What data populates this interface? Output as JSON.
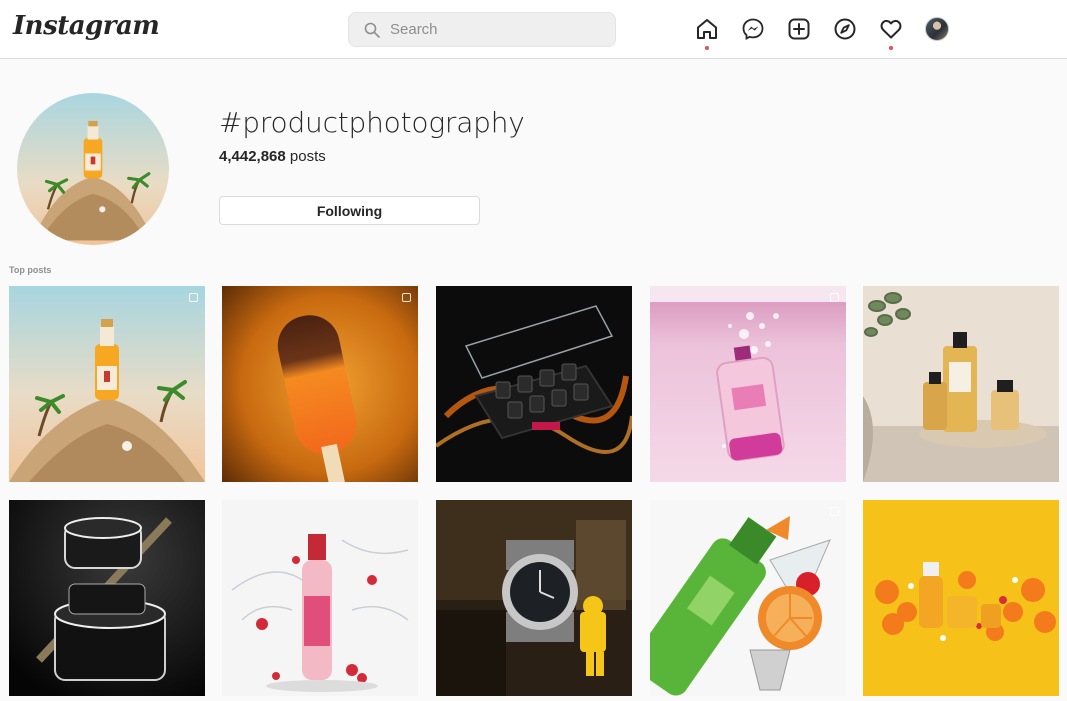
{
  "header": {
    "logo": "Instagram",
    "search": {
      "placeholder": "Search",
      "value": ""
    },
    "nav": [
      {
        "icon": "home-icon",
        "label": "Home",
        "notification": true
      },
      {
        "icon": "messenger-icon",
        "label": "Direct"
      },
      {
        "icon": "new-post-icon",
        "label": "New post"
      },
      {
        "icon": "explore-icon",
        "label": "Explore"
      },
      {
        "icon": "activity-heart-icon",
        "label": "Activity",
        "notification": true
      },
      {
        "icon": "profile-avatar",
        "label": "Profile"
      }
    ],
    "accent": "#ed4956"
  },
  "hashtag": {
    "name": "#productphotography",
    "post_count": "4,442,868",
    "post_suffix": " posts",
    "follow_button": "Following"
  },
  "section": {
    "label": "Top posts"
  },
  "posts": [
    {
      "subject": "orange juice bottle on sand island with palm trees",
      "multi": true
    },
    {
      "subject": "chocolate and orange popsicle on orange background",
      "multi": true
    },
    {
      "subject": "nail polish bottles in black box with acrylic lid and orange light trails"
    },
    {
      "subject": "perfume bottle splashing in pink water",
      "multi": true
    },
    {
      "subject": "skincare dropper bottles on tray with eucalyptus"
    },
    {
      "subject": "black cosmetic cream jars on dark background"
    },
    {
      "subject": "pink drink bottle with water splash and raspberries"
    },
    {
      "subject": "wristwatch with lego figure on vintage desk"
    },
    {
      "subject": "green gin bottle with orange slices and cocktail glass",
      "multi": true
    },
    {
      "subject": "skincare products with orange slices on yellow background"
    }
  ]
}
